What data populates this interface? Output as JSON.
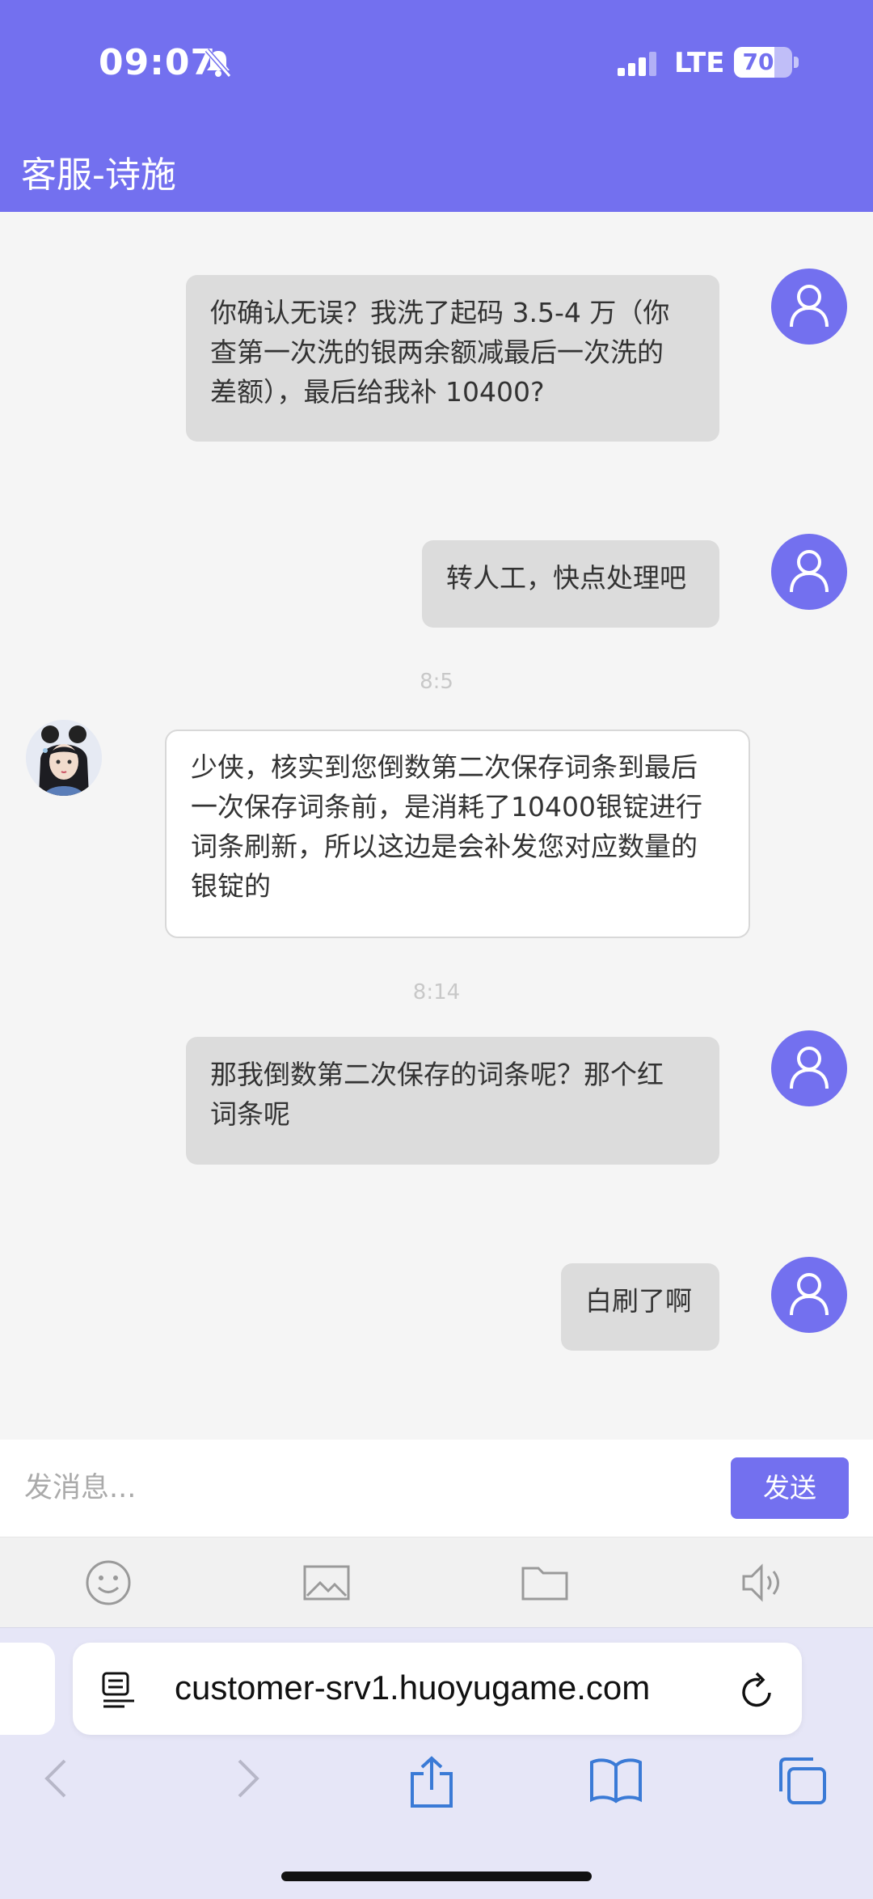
{
  "status_bar": {
    "time": "09:07",
    "network": "LTE",
    "battery": "70",
    "battery_level_percent": 70
  },
  "header": {
    "title": "客服-诗施"
  },
  "messages": [
    {
      "side": "out",
      "lines": [
        "你确认无误？我洗了起码 3.5-4 万（你",
        "查第一次洗的银两余额减最后一次洗的",
        "差额），最后给我补 10400?"
      ]
    },
    {
      "side": "out",
      "lines": [
        "转人工，快点处理吧"
      ]
    },
    {
      "side": "time",
      "text": "8:5"
    },
    {
      "side": "in",
      "lines": [
        "少侠，核实到您倒数第二次保存词条到最后",
        "一次保存词条前，是消耗了10400银锭进行",
        "词条刷新，所以这边是会补发您对应数量的",
        "银锭的"
      ]
    },
    {
      "side": "time",
      "text": "8:14"
    },
    {
      "side": "out",
      "lines": [
        "那我倒数第二次保存的词条呢？那个红",
        "词条呢"
      ]
    },
    {
      "side": "out",
      "lines": [
        "白刷了啊"
      ]
    }
  ],
  "input": {
    "placeholder": "发消息...",
    "value": "",
    "send_label": "发送"
  },
  "toolbar": {
    "icons": [
      "emoji-icon",
      "image-icon",
      "folder-icon",
      "voice-icon"
    ]
  },
  "browser": {
    "url": "customer-srv1.huoyugame.com"
  },
  "colors": {
    "accent": "#7370ef",
    "bubble_out": "#dcdcdc",
    "bubble_in": "#ffffff"
  }
}
